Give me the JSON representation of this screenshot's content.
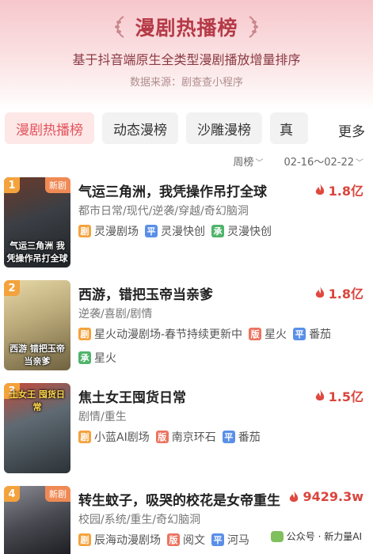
{
  "header": {
    "title": "漫剧热播榜",
    "subtitle": "基于抖音端原生全类型漫剧播放增量排序",
    "source": "数据来源：剧查查小程序"
  },
  "tabs": [
    "漫剧热播榜",
    "动态漫榜",
    "沙雕漫榜",
    "真"
  ],
  "more_label": "更多",
  "filters": {
    "period": "周榜",
    "date_range": "02-16～02-22"
  },
  "items": [
    {
      "rank": "1",
      "badge": "新剧",
      "cover_caption": "气运三角洲 我凭操作吊打全球",
      "cover_color": "#3b3f45",
      "title": "气运三角洲，我凭操作吊打全球",
      "heat": "1.8亿",
      "genre": "都市日常/现代/逆袭/穿越/奇幻脑洞",
      "tags": [
        {
          "type": "剧",
          "text": "灵漫剧场"
        },
        {
          "type": "平",
          "text": "灵漫快创"
        },
        {
          "type": "承",
          "text": "灵漫快创"
        }
      ]
    },
    {
      "rank": "2",
      "badge": "",
      "cover_caption": "西游 错把玉帝当亲爹",
      "cover_color": "#b9a878",
      "title": "西游，错把玉帝当亲爹",
      "heat": "1.8亿",
      "genre": "逆袭/喜剧/剧情",
      "tags": [
        {
          "type": "剧",
          "text": "星火动漫剧场-春节持续更新中"
        },
        {
          "type": "版",
          "text": "星火"
        },
        {
          "type": "平",
          "text": "番茄"
        },
        {
          "type": "承",
          "text": "星火"
        }
      ]
    },
    {
      "rank": "3",
      "badge": "",
      "cover_caption": "土女王 囤货日常",
      "cover_color": "#5f6a72",
      "title": "焦土女王囤货日常",
      "heat": "1.5亿",
      "genre": "剧情/重生",
      "tags": [
        {
          "type": "剧",
          "text": "小蓝AI剧场"
        },
        {
          "type": "版",
          "text": "南京环石"
        },
        {
          "type": "平",
          "text": "番茄"
        }
      ]
    },
    {
      "rank": "4",
      "badge": "新剧",
      "cover_caption": "",
      "cover_color": "#4a4a52",
      "title": "转生蚊子，吸哭的校花是女帝重生",
      "heat": "9429.3w",
      "genre": "校园/系统/重生/奇幻脑洞",
      "tags": [
        {
          "type": "剧",
          "text": "辰海动漫剧场"
        },
        {
          "type": "版",
          "text": "阅文"
        },
        {
          "type": "平",
          "text": "河马"
        }
      ]
    }
  ],
  "watermark": "公众号 · 新力量AI",
  "colors": {
    "accent": "#e2545c",
    "title": "#b53a47",
    "heat": "#d9453d",
    "rank_badge": "#f4a23c"
  }
}
